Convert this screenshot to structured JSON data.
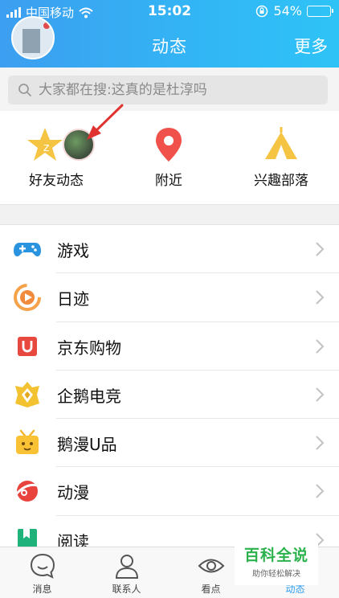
{
  "status_bar": {
    "carrier": "中国移动",
    "time": "15:02",
    "battery": "54%",
    "battery_level": 0.54
  },
  "header": {
    "title": "动态",
    "more": "更多"
  },
  "search": {
    "placeholder": "大家都在搜:这真的是杜淳吗"
  },
  "quick_actions": [
    {
      "label": "好友动态",
      "icon": "star-icon"
    },
    {
      "label": "附近",
      "icon": "location-pin-icon"
    },
    {
      "label": "兴趣部落",
      "icon": "tent-icon"
    }
  ],
  "list": [
    {
      "label": "游戏",
      "icon": "gamepad-icon"
    },
    {
      "label": "日迹",
      "icon": "play-circle-icon"
    },
    {
      "label": "京东购物",
      "icon": "jd-bag-icon"
    },
    {
      "label": "企鹅电竞",
      "icon": "esports-crown-icon"
    },
    {
      "label": "鹅漫U品",
      "icon": "gift-box-icon"
    },
    {
      "label": "动漫",
      "icon": "comic-icon"
    },
    {
      "label": "阅读",
      "icon": "book-icon"
    }
  ],
  "tabbar": [
    {
      "label": "消息",
      "icon": "message-bubble-icon"
    },
    {
      "label": "联系人",
      "icon": "contacts-person-icon"
    },
    {
      "label": "看点",
      "icon": "eye-icon"
    },
    {
      "label": "动态",
      "icon": "star-tab-icon"
    }
  ],
  "watermark": {
    "main": "百科全说",
    "sub": "助你轻松解决"
  },
  "colors": {
    "header_gradient_start": "#3c9ef0",
    "header_gradient_end": "#2ec3f6",
    "accent_blue": "#2f9ef0",
    "star_yellow": "#f6c443",
    "pin_red": "#f0524b",
    "arrow_red": "#e0322e"
  }
}
